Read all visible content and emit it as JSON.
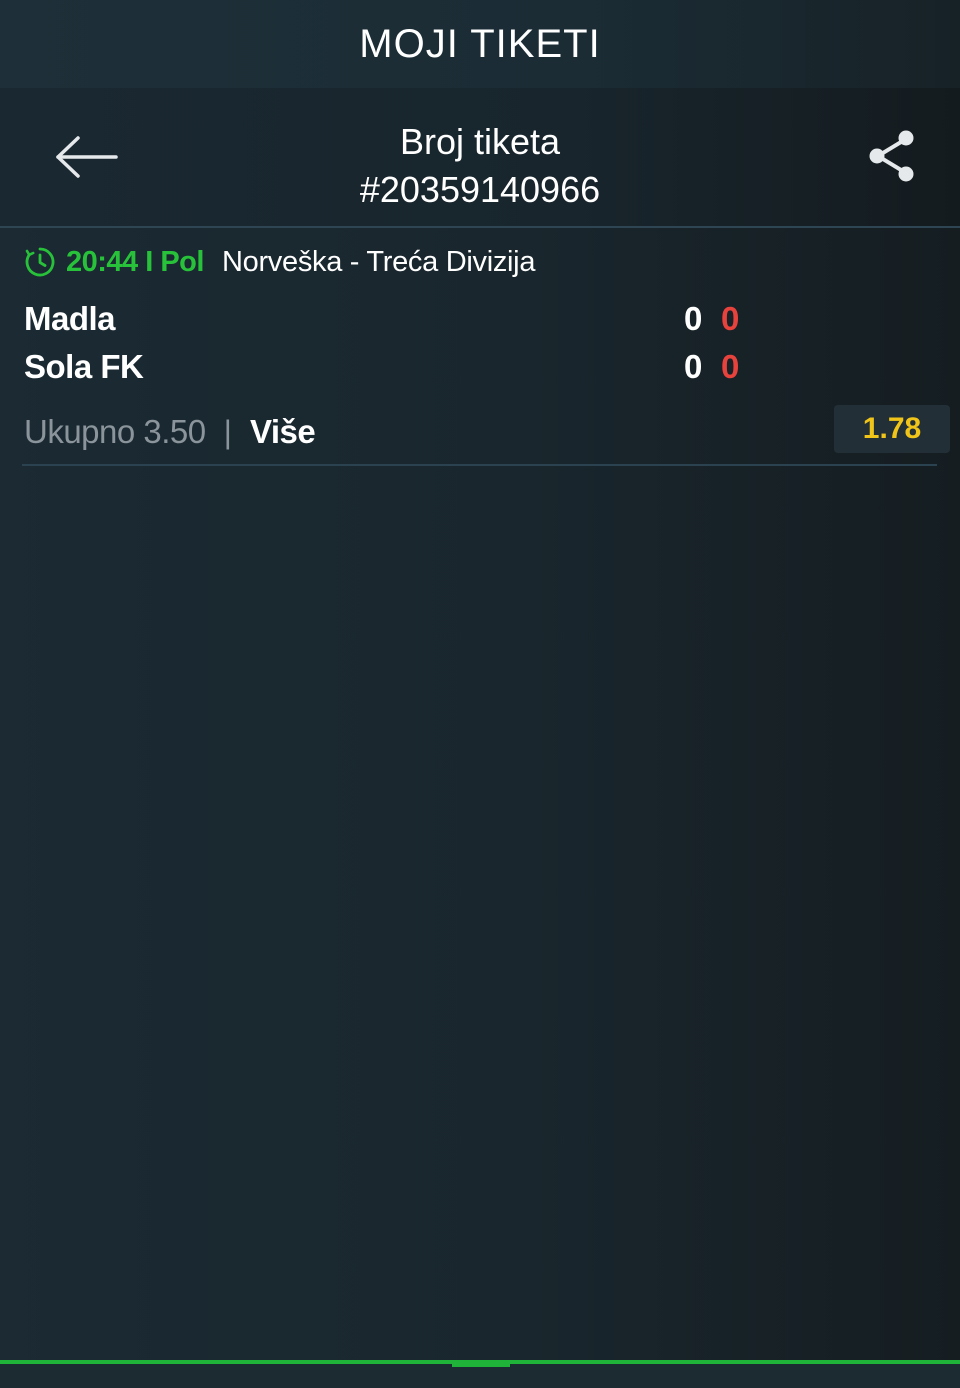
{
  "app": {
    "title": "MOJI TIKETI"
  },
  "ticket": {
    "label": "Broj tiketa",
    "number": "#20359140966"
  },
  "event": {
    "time_status": "20:44 I Pol",
    "league": "Norveška - Treća Divizija",
    "home_team": "Madla",
    "away_team": "Sola FK",
    "home_score": "0",
    "home_period_score": "0",
    "away_score": "0",
    "away_period_score": "0",
    "market": "Ukupno 3.50",
    "separator": "|",
    "selection": "Više",
    "odds": "1.78"
  },
  "icons": {
    "back": "arrow-left-icon",
    "share": "share-icon",
    "clock": "clock-icon"
  },
  "colors": {
    "live_green": "#28c23a",
    "odds_yellow": "#f0c419",
    "score_red": "#e8423d",
    "muted_text": "#8a949a",
    "accent_line": "#1fb33a"
  }
}
